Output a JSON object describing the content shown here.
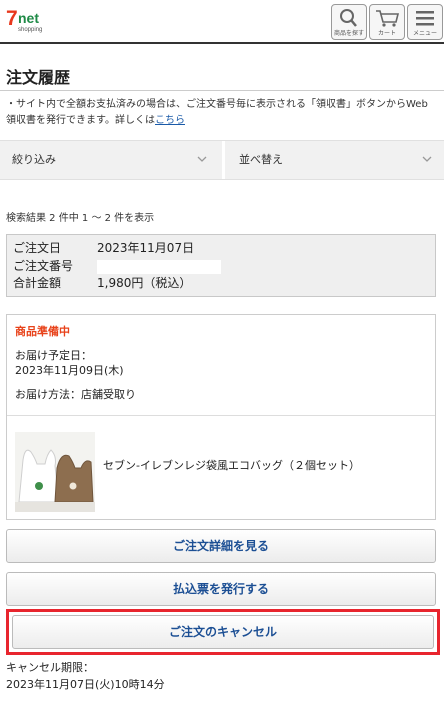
{
  "header": {
    "logo_seven": "7",
    "logo_net": "net",
    "logo_shopping": "shopping",
    "buttons": [
      {
        "icon": "search-icon",
        "label": "商品を探す"
      },
      {
        "icon": "cart-icon",
        "label": "カート"
      },
      {
        "icon": "menu-icon",
        "label": "メニュー"
      }
    ]
  },
  "page_title": "注文履歴",
  "notice": {
    "text": "・サイト内で全額お支払済みの場合は、ご注文番号毎に表示される「領収書」ボタンからWeb領収書を発行できます。詳しくは",
    "link": "こちら"
  },
  "filters": {
    "narrow": "絞り込み",
    "sort": "並べ替え"
  },
  "result_text": "検索結果 2 件中 1 ～ 2 件を表示",
  "order_summary": {
    "date_label": "ご注文日",
    "date_value": "2023年11月07日",
    "number_label": "ご注文番号",
    "number_value": "",
    "total_label": "合計金額",
    "total_value": "1,980円（税込）"
  },
  "order_card": {
    "status": "商品準備中",
    "delivery_date_label": "お届け予定日：",
    "delivery_date_value": "2023年11月09日(木)",
    "delivery_method": "お届け方法：店舗受取り",
    "product_name": "セブン-イレブンレジ袋風エコバッグ（２個セット）"
  },
  "buttons": {
    "detail": "ご注文詳細を見る",
    "payment_slip": "払込票を発行する",
    "cancel": "ご注文のキャンセル"
  },
  "cancel_deadline": {
    "label": "キャンセル期限：",
    "value": "2023年11月07日(火)10時14分"
  },
  "colors": {
    "status": "#e8421a",
    "button_text": "#1c4f94",
    "highlight": "#e8252e"
  }
}
